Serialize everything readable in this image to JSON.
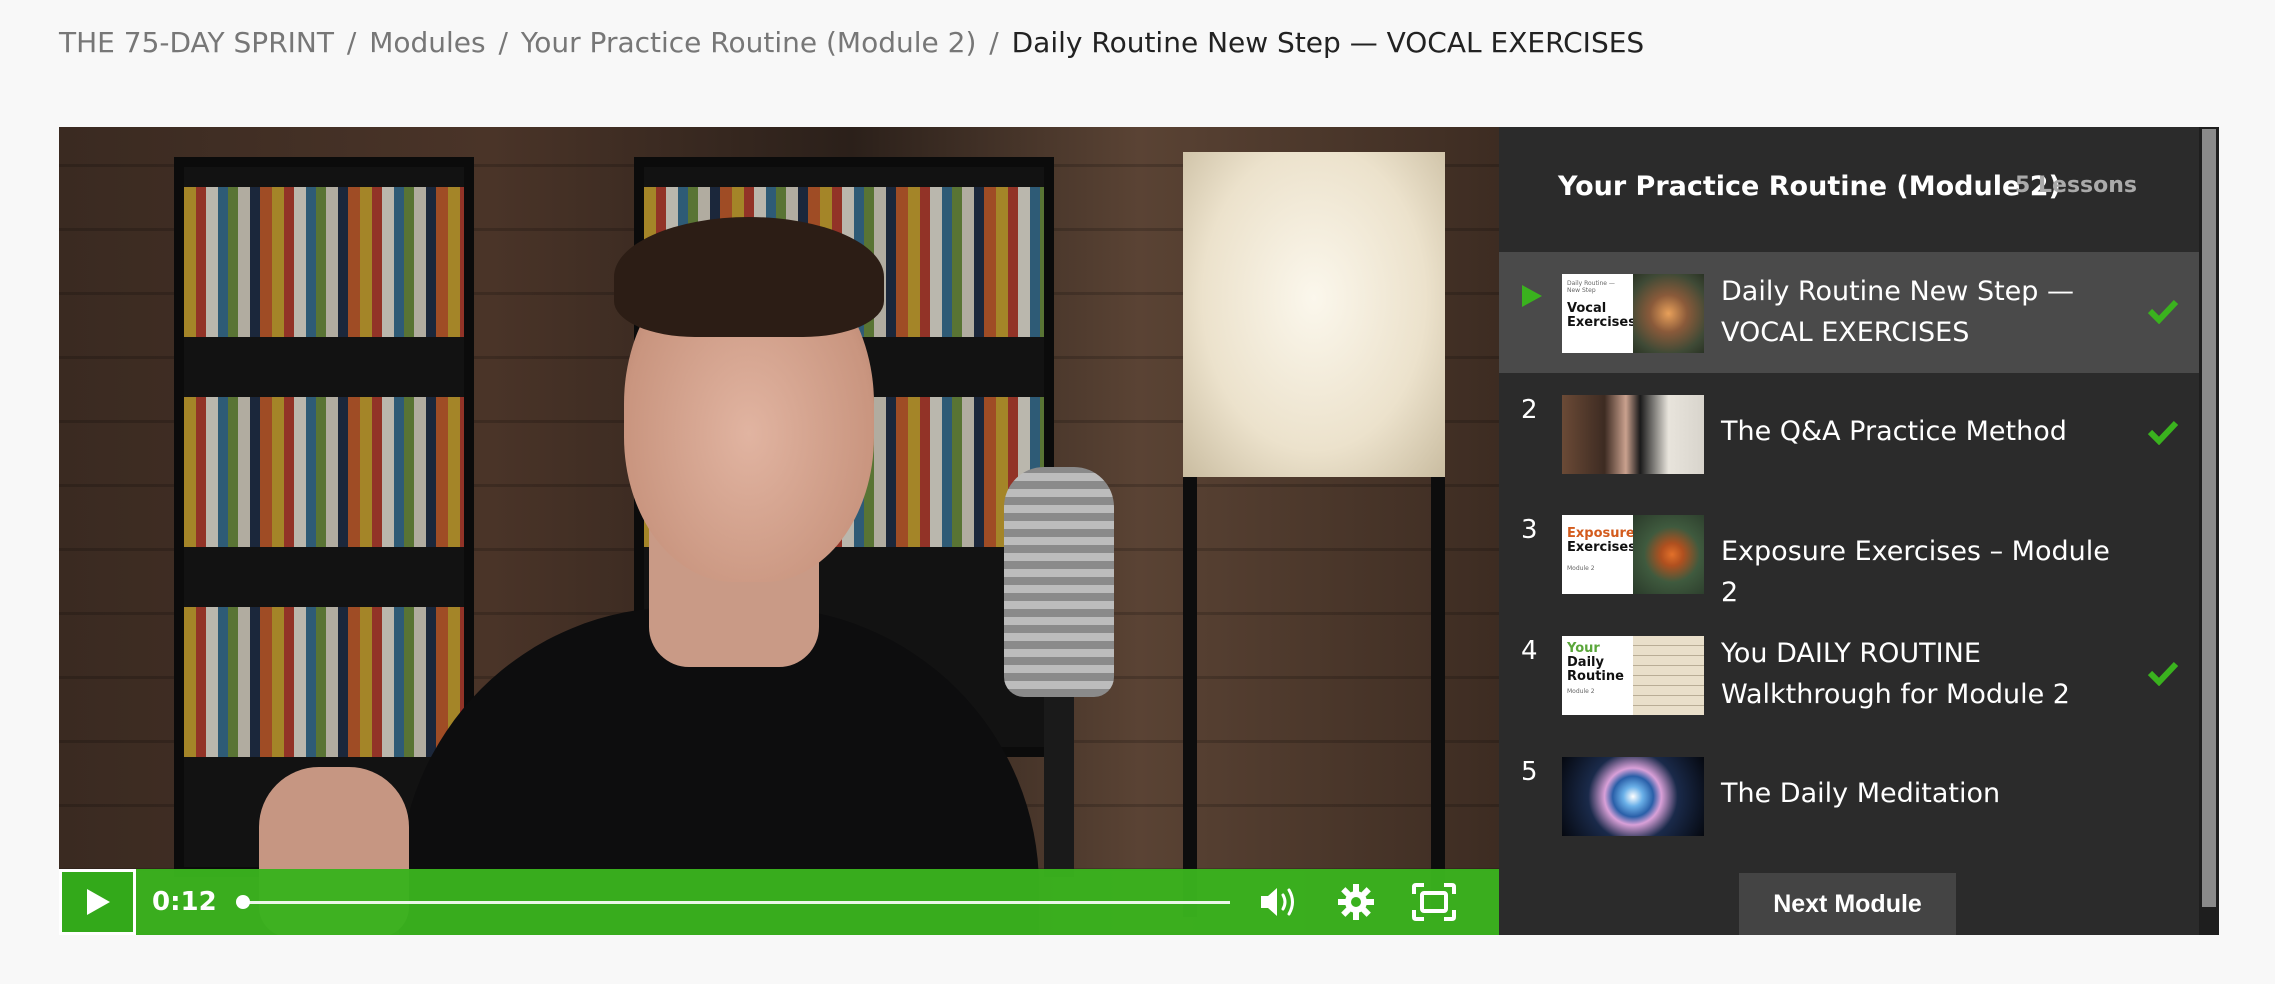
{
  "breadcrumb": {
    "course": "THE 75-DAY SPRINT",
    "modules": "Modules",
    "module": "Your Practice Routine (Module 2)",
    "current": "Daily Routine New Step — VOCAL EXERCISES",
    "separator": "/"
  },
  "player": {
    "time": "0:12",
    "progress": 0.0,
    "accent": "#3ab21e"
  },
  "sidebar": {
    "title": "Your Practice Routine (Module 2)",
    "count": "5 Lessons",
    "lessons": [
      {
        "num": "",
        "title": "Daily Routine New Step — VOCAL EXERCISES",
        "completed": true,
        "active": true,
        "thumb_text": {
          "tiny": "Daily Routine — New Step",
          "line1": "Vocal",
          "line2": "Exercises"
        }
      },
      {
        "num": "2",
        "title": "The Q&A Practice Method",
        "completed": true,
        "active": false
      },
      {
        "num": "3",
        "title": "Exposure Exercises – Module 2",
        "completed": false,
        "active": false,
        "thumb_text": {
          "line1": "Exposure",
          "line2": "Exercises",
          "tiny": "Module 2"
        }
      },
      {
        "num": "4",
        "title": "You DAILY ROUTINE Walkthrough for Module 2",
        "completed": true,
        "active": false,
        "thumb_text": {
          "line1": "Your",
          "line2": "Daily",
          "line3": "Routine",
          "tiny": "Module 2"
        }
      },
      {
        "num": "5",
        "title": "The Daily Meditation",
        "completed": false,
        "active": false
      }
    ],
    "next_label": "Next Module",
    "check_color": "#3ab21e"
  }
}
